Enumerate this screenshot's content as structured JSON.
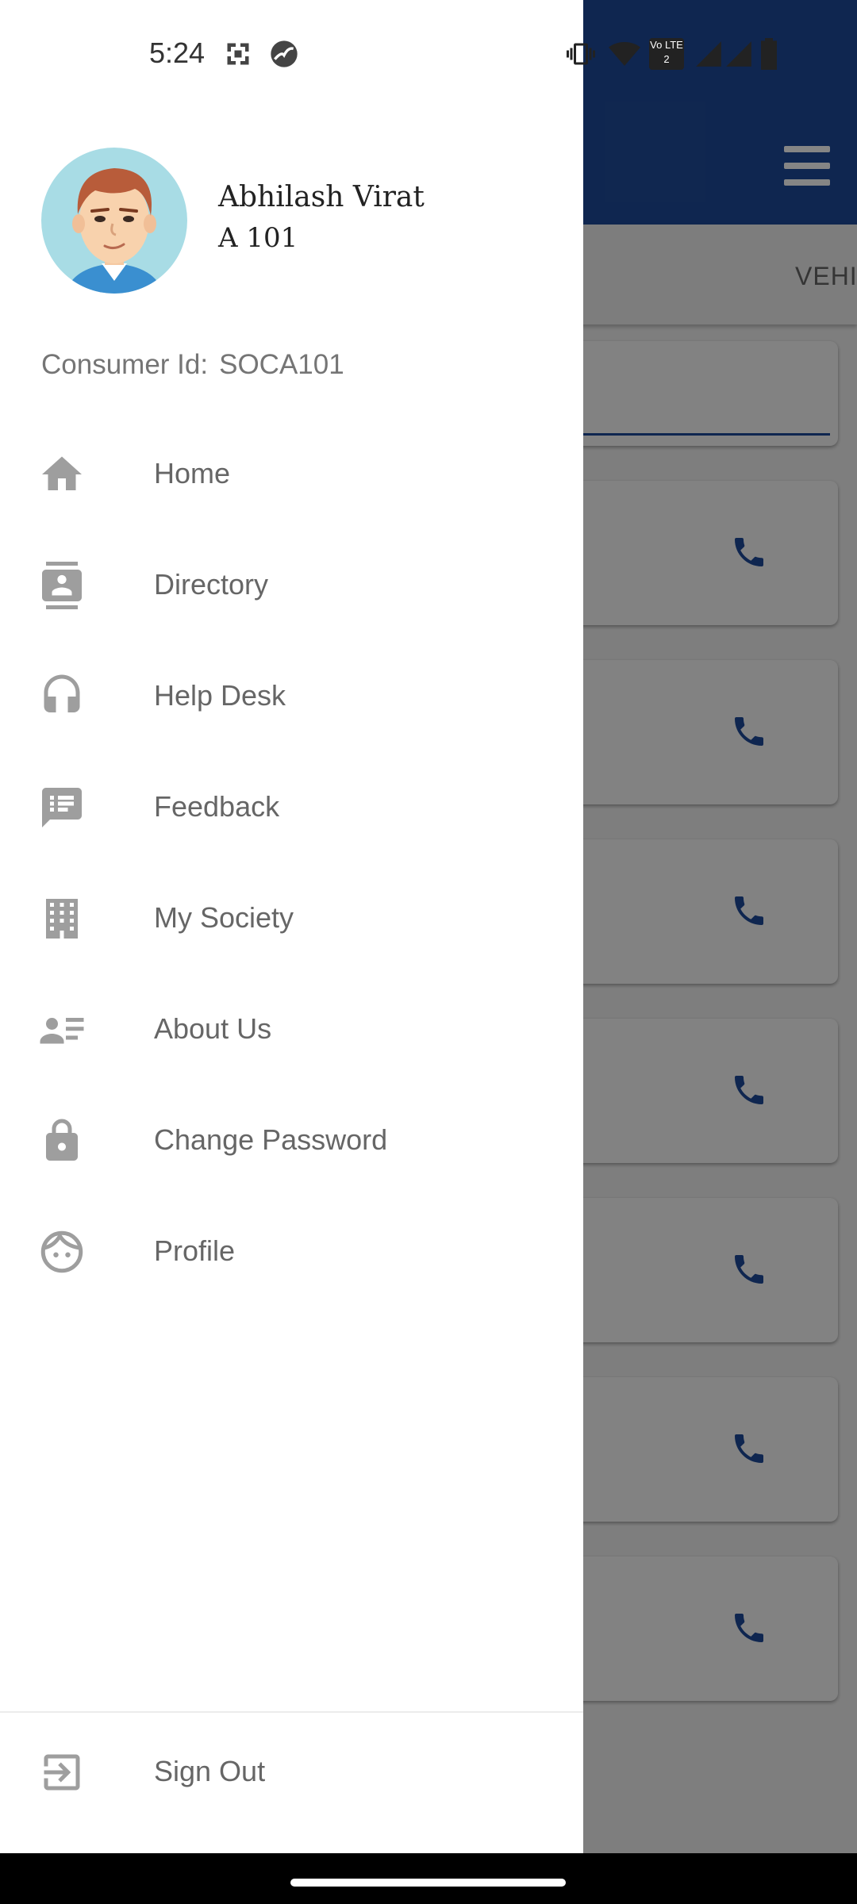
{
  "status_bar": {
    "time": "5:24",
    "icons": [
      "screenshot-icon",
      "app-icon",
      "vibrate-icon",
      "wifi-icon",
      "volte-icon",
      "signal-icon",
      "signal-icon",
      "battery-icon"
    ],
    "volte_label": "Vo LTE 2"
  },
  "background_app": {
    "tab_label": "VEHI",
    "accent_color": "#1e4a9a",
    "contact_cards": [
      {
        "icon": "phone-icon"
      },
      {
        "icon": "phone-icon"
      },
      {
        "icon": "phone-icon"
      },
      {
        "icon": "phone-icon"
      },
      {
        "icon": "phone-icon"
      },
      {
        "icon": "phone-icon"
      },
      {
        "icon": "phone-icon"
      }
    ]
  },
  "drawer": {
    "user": {
      "name": "Abhilash Virat",
      "unit": "A 101"
    },
    "consumer": {
      "label": "Consumer Id:",
      "value": "SOCA101"
    },
    "menu": [
      {
        "label": "Home",
        "icon": "home-icon"
      },
      {
        "label": "Directory",
        "icon": "contacts-icon"
      },
      {
        "label": "Help Desk",
        "icon": "headset-icon"
      },
      {
        "label": "Feedback",
        "icon": "feedback-icon"
      },
      {
        "label": "My Society",
        "icon": "building-icon"
      },
      {
        "label": "About Us",
        "icon": "about-icon"
      },
      {
        "label": "Change Password",
        "icon": "lock-icon"
      },
      {
        "label": "Profile",
        "icon": "face-icon"
      }
    ],
    "sign_out": {
      "label": "Sign Out",
      "icon": "exit-icon"
    }
  }
}
